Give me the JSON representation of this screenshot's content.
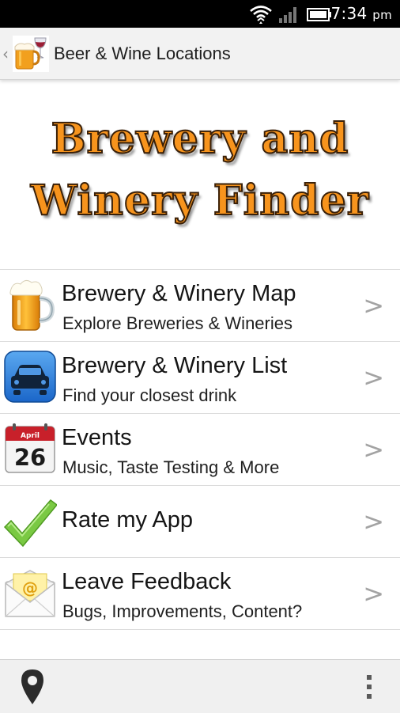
{
  "status_bar": {
    "time": "7:34",
    "ampm": "pm",
    "icons": [
      "wifi-icon",
      "signal-icon",
      "battery-icon"
    ]
  },
  "action_bar": {
    "back_icon": "chevron-left-icon",
    "app_icon": "beer-wine-logo",
    "title": "Beer & Wine Locations"
  },
  "banner": {
    "line1": "Brewery and",
    "line2": "Winery Finder"
  },
  "menu": {
    "items": [
      {
        "title": "Brewery & Winery Map",
        "subtitle": "Explore Breweries & Wineries",
        "icon": "beer-mug-icon",
        "arrow": ">"
      },
      {
        "title": "Brewery & Winery List",
        "subtitle": "Find your closest drink",
        "icon": "car-icon",
        "arrow": ">"
      },
      {
        "title": "Events",
        "subtitle": "Music, Taste Testing & More",
        "icon": "calendar-icon",
        "calendar_month": "April",
        "calendar_day": "26",
        "arrow": ">"
      },
      {
        "title": "Rate my App",
        "subtitle": "",
        "icon": "checkmark-icon",
        "arrow": ">"
      },
      {
        "title": "Leave Feedback",
        "subtitle": "Bugs, Improvements, Content?",
        "icon": "email-icon",
        "arrow": ">"
      }
    ]
  },
  "bottom_bar": {
    "left_icon": "location-pin-icon",
    "right_icon": "overflow-menu-icon"
  },
  "colors": {
    "banner_orange": "#f7941d",
    "banner_outline": "#3a2008",
    "arrow_gray": "#a3a3a3",
    "checkmark_green": "#7ac943"
  }
}
